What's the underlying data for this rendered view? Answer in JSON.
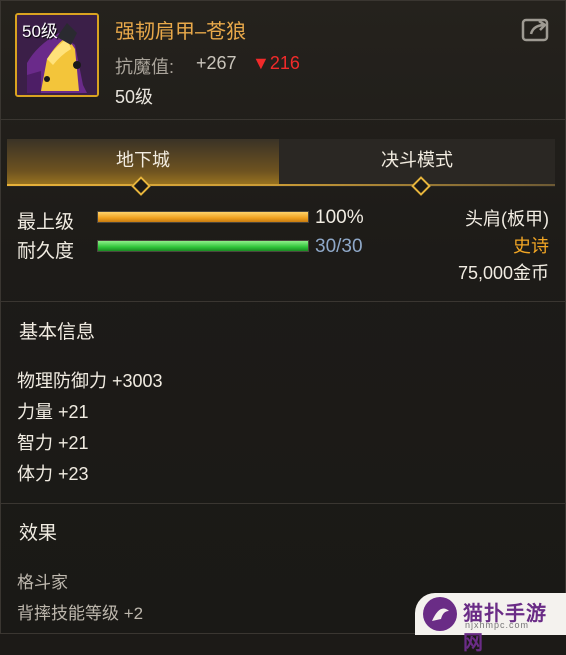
{
  "item": {
    "level_badge": "50级",
    "name": "强韧肩甲–苍狼",
    "stat_label": "抗魔值:",
    "stat_value": "+267",
    "stat_diff": "▼216",
    "level_text": "50级"
  },
  "tabs": [
    {
      "label": "地下城",
      "active": true
    },
    {
      "label": "决斗模式",
      "active": false
    }
  ],
  "bars": [
    {
      "label": "最上级",
      "value_text": "100%",
      "percent": 100,
      "color": "#f0a11f",
      "value_color": "#f1ece2"
    },
    {
      "label": "耐久度",
      "value_text": "30/30",
      "percent": 100,
      "color": "#2fc43a",
      "value_color": "#8fa8c8"
    }
  ],
  "info": {
    "slot": "头肩(板甲)",
    "rarity": "史诗",
    "rarity_color": "#f2a624",
    "price": "75,000金币"
  },
  "basic": {
    "title": "基本信息",
    "attrs": [
      "物理防御力 +3003",
      "力量 +21",
      "智力 +21",
      "体力 +23"
    ]
  },
  "effects": {
    "title": "效果",
    "lines": [
      "格斗家",
      "背摔技能等级 +2"
    ]
  },
  "watermark": {
    "title": "猫扑手游网",
    "url": "njxhmpc.com"
  }
}
